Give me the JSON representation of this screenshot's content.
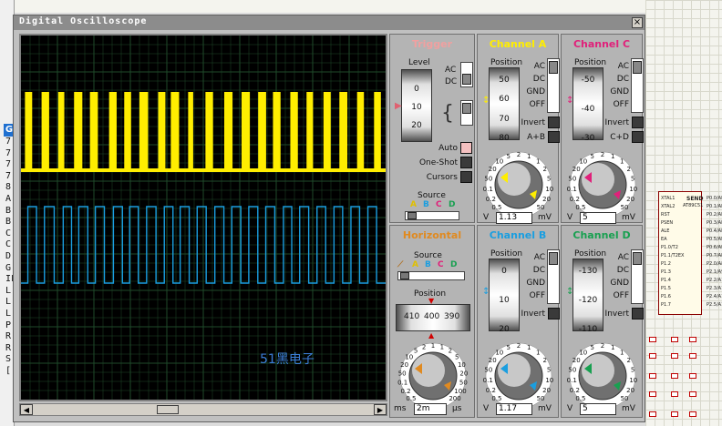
{
  "window": {
    "title": "Digital Oscilloscope",
    "close_label": "×"
  },
  "side_letters": [
    "7",
    "7",
    "7",
    "7",
    "8",
    "A",
    "B",
    "B",
    "C",
    "C",
    "D",
    "G",
    "IF",
    "L",
    "L",
    "L",
    "P",
    "R",
    "R",
    "S",
    "["
  ],
  "side_tab": "G",
  "watermark": "51黑电子",
  "trigger": {
    "title": "Trigger",
    "level_label": "Level",
    "level_ticks": [
      "0",
      "10",
      "20"
    ],
    "coupling": [
      "AC",
      "DC"
    ],
    "auto_label": "Auto",
    "oneshot_label": "One-Shot",
    "cursors_label": "Cursors",
    "source_label": "Source",
    "source_letters": [
      "A",
      "B",
      "C",
      "D"
    ]
  },
  "horizontal": {
    "title": "Horizontal",
    "source_label": "Source",
    "source_letters": [
      "A",
      "B",
      "C",
      "D"
    ],
    "position_label": "Position",
    "position_ticks": [
      "410",
      "400",
      "390"
    ],
    "knob_ticks": [
      "0.5",
      "0.2",
      "0.1",
      "50",
      "20",
      "10",
      "5",
      "2",
      "1",
      "1",
      "2",
      "5",
      "10",
      "20",
      "50",
      "100",
      "200"
    ],
    "unit_left": "ms",
    "value": "2m",
    "unit_right": "μs"
  },
  "channels": [
    {
      "key": "A",
      "title": "Channel A",
      "color": "#ffee00",
      "position_label": "Position",
      "ticks": [
        "50",
        "60",
        "70",
        "80"
      ],
      "modes": [
        "AC",
        "DC",
        "GND",
        "OFF"
      ],
      "invert_label": "Invert",
      "extra_label": "A+B",
      "knob_ticks": [
        "0.5",
        "0.2",
        "0.1",
        "50",
        "20",
        "10",
        "5",
        "2",
        "1",
        "1",
        "2",
        "5",
        "10",
        "20",
        "50"
      ],
      "unit_left": "V",
      "value": "1.13",
      "unit_right": "mV"
    },
    {
      "key": "C",
      "title": "Channel C",
      "color": "#e0207a",
      "position_label": "Position",
      "ticks": [
        "-50",
        "-40",
        "-30"
      ],
      "modes": [
        "AC",
        "DC",
        "GND",
        "OFF"
      ],
      "invert_label": "Invert",
      "extra_label": "C+D",
      "knob_ticks": [
        "0.5",
        "0.2",
        "0.1",
        "50",
        "20",
        "10",
        "5",
        "2",
        "1",
        "1",
        "2",
        "5",
        "10",
        "20",
        "50"
      ],
      "unit_left": "V",
      "value": "5",
      "unit_right": "mV"
    },
    {
      "key": "B",
      "title": "Channel B",
      "color": "#1a9ee0",
      "position_label": "Position",
      "ticks": [
        "0",
        "10",
        "20"
      ],
      "modes": [
        "AC",
        "DC",
        "GND",
        "OFF"
      ],
      "invert_label": "Invert",
      "extra_label": "",
      "knob_ticks": [
        "0.5",
        "0.2",
        "0.1",
        "50",
        "20",
        "10",
        "5",
        "2",
        "1",
        "1",
        "2",
        "5",
        "10",
        "20",
        "50"
      ],
      "unit_left": "V",
      "value": "1.17",
      "unit_right": "mV"
    },
    {
      "key": "D",
      "title": "Channel D",
      "color": "#18a050",
      "position_label": "Position",
      "ticks": [
        "-130",
        "-120",
        "-110"
      ],
      "modes": [
        "AC",
        "DC",
        "GND",
        "OFF"
      ],
      "invert_label": "Invert",
      "extra_label": "",
      "knob_ticks": [
        "0.5",
        "0.2",
        "0.1",
        "50",
        "20",
        "10",
        "5",
        "2",
        "1",
        "1",
        "2",
        "5",
        "10",
        "20",
        "50"
      ],
      "unit_left": "V",
      "value": "5",
      "unit_right": "mV"
    }
  ],
  "schematic": {
    "chip_title": "SEND",
    "chip_part": "AT89C51",
    "pin_left": [
      "XTAL1",
      "XTAL2",
      "RST",
      "PSEN",
      "ALE",
      "EA",
      "P1.0/T2",
      "P1.1/T2EX",
      "P1.2",
      "P1.3",
      "P1.4",
      "P1.5",
      "P1.6",
      "P1.7"
    ],
    "pin_right": [
      "P0.0/AD0",
      "P0.1/AD1",
      "P0.2/AD2",
      "P0.3/AD3",
      "P0.4/AD4",
      "P0.5/AD5",
      "P0.6/AD6",
      "P0.7/AD7",
      "P2.0/A8",
      "P2.1/A9",
      "P2.2/A10",
      "P2.3/A11",
      "P2.4/A12",
      "P2.5/A13"
    ]
  },
  "colors": {
    "screen_bg": "#000000",
    "grid": "#1f4a2a",
    "trace_a": "#ffee00",
    "trace_b": "#1a9ee0",
    "panel": "#b4b4b4"
  },
  "trace_a_edges": [
    0.6,
    2.6,
    5.2,
    7.3,
    9.8,
    11.5,
    14.2,
    16.5,
    18.6,
    20.8,
    23.9,
    26.0,
    28.1,
    30.0,
    32.3,
    34.7,
    37.5,
    39.5,
    41.0,
    43.3,
    45.8,
    47.2,
    50.6,
    52.7,
    55.8,
    58.1,
    60.6,
    62.9,
    65.2,
    67.4,
    69.3,
    71.4,
    74.1,
    76.2,
    78.6,
    80.4,
    83.3,
    85.3,
    87.7,
    89.9,
    92.6,
    94.5,
    97.3,
    99.2
  ],
  "trace_b_edges": [
    1.4,
    3.8,
    6.0,
    8.7,
    11.2,
    13.5,
    15.5,
    18.0,
    20.1,
    22.6,
    25.1,
    27.6,
    29.6,
    32.0,
    34.3,
    36.9,
    39.2,
    41.6,
    43.6,
    46.1,
    48.3,
    50.8,
    53.2,
    55.7,
    57.9,
    60.4,
    62.6,
    65.1,
    67.3,
    69.8,
    72.2,
    74.5,
    76.7,
    79.2,
    81.5,
    83.9,
    86.2,
    88.6,
    90.9,
    93.3,
    95.6,
    98.0
  ]
}
